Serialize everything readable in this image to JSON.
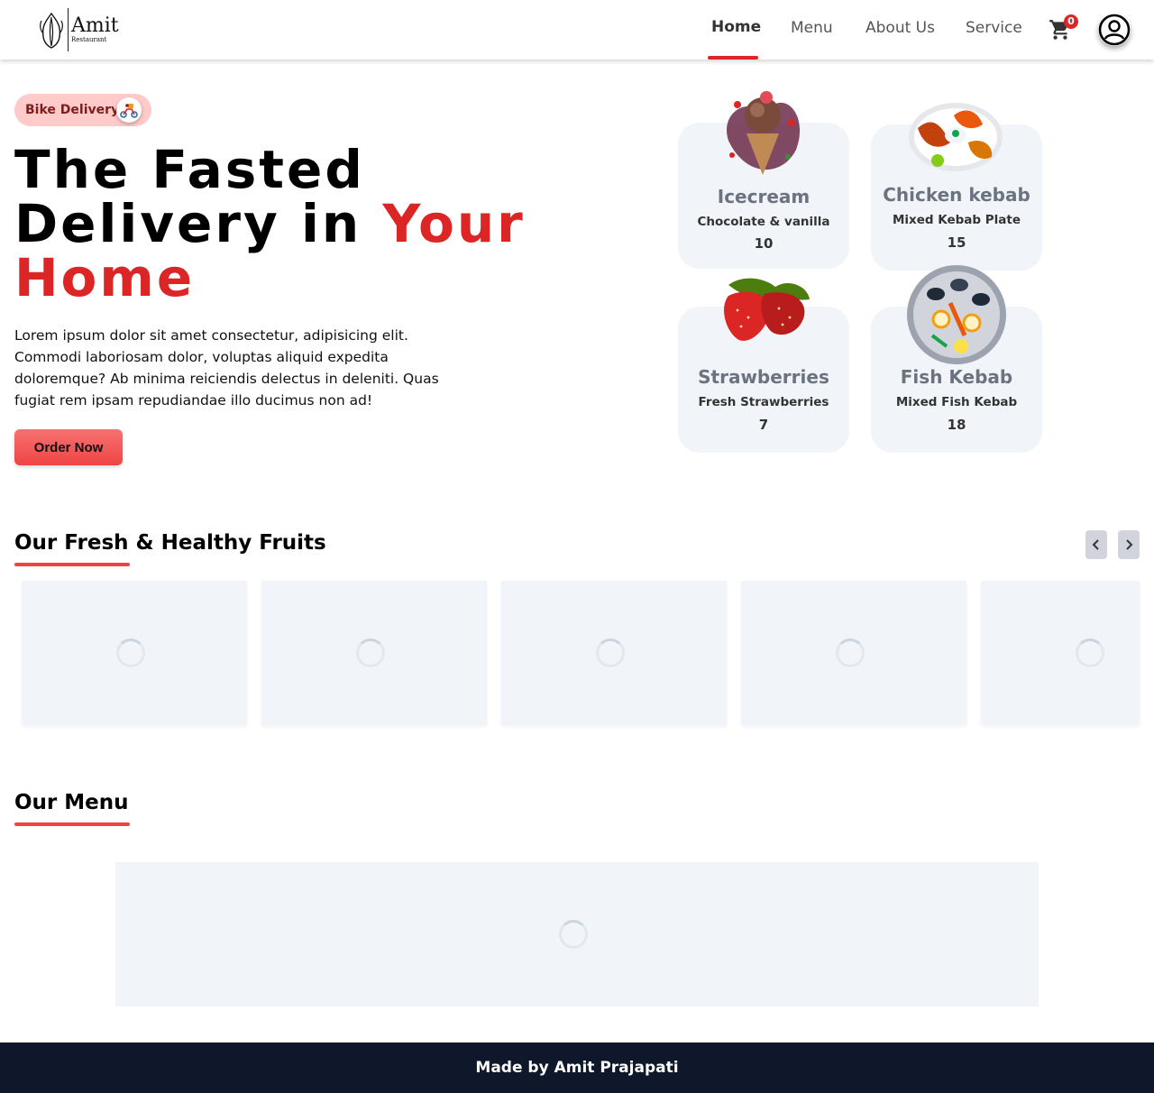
{
  "header": {
    "logo": {
      "name": "Amit",
      "sub": "Restaurant"
    },
    "nav": [
      {
        "label": "Home",
        "active": true
      },
      {
        "label": "Menu"
      },
      {
        "label": "About Us"
      },
      {
        "label": "Service"
      }
    ],
    "cart": {
      "icon": "cart-icon",
      "count": "0"
    },
    "avatar_icon": "user-circle-icon"
  },
  "hero": {
    "pill": {
      "label": "Bike Delivery",
      "icon": "delivery-bike-icon"
    },
    "title": {
      "line1": "The Fasted",
      "line2_prefix": "Delivery in ",
      "line2_accent": "Your",
      "line3_accent": "Home"
    },
    "description": "Lorem ipsum dolor sit amet consectetur, adipisicing elit. Commodi laboriosam dolor, voluptas aliquid expedita doloremque? Ab minima reiciendis delectus in deleniti. Quas fugiat rem ipsam repudiandae illo ducimus non ad!",
    "cta": "Order Now"
  },
  "cards": [
    {
      "title": "Icecream",
      "subtitle": "Chocolate & vanilla",
      "price": "10"
    },
    {
      "title": "Chicken kebab",
      "subtitle": "Mixed Kebab Plate",
      "price": "15"
    },
    {
      "title": "Strawberries",
      "subtitle": "Fresh Strawberries",
      "price": "7"
    },
    {
      "title": "Fish Kebab",
      "subtitle": "Mixed Fish Kebab",
      "price": "18"
    }
  ],
  "fruits_section": {
    "title": "Our Fresh & Healthy Fruits",
    "prev_icon": "chevron-left-icon",
    "next_icon": "chevron-right-icon"
  },
  "menu_section": {
    "title": "Our Menu"
  },
  "colors": {
    "accent": "#dc2626",
    "card_bg": "#f1f5f9",
    "footer_bg": "#0f172a"
  },
  "footer": {
    "text": "Made by Amit Prajapati"
  }
}
